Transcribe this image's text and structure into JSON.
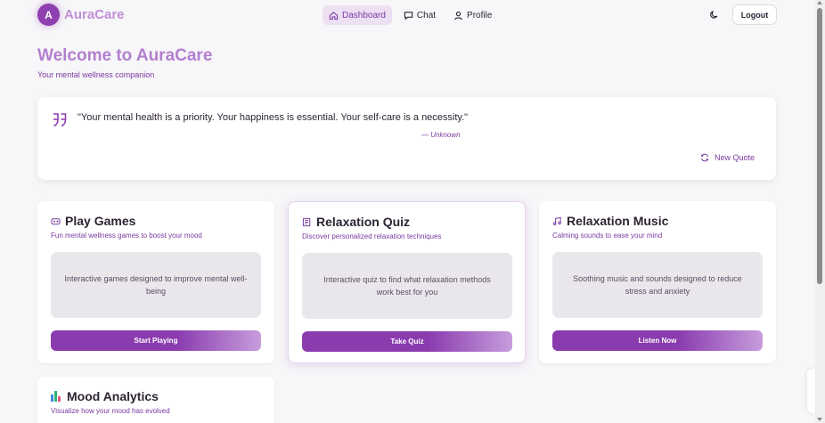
{
  "brand": {
    "initial": "A",
    "name": "AuraCare"
  },
  "nav": {
    "links": [
      {
        "label": "Dashboard",
        "icon": "home-icon",
        "active": true
      },
      {
        "label": "Chat",
        "icon": "chat-icon",
        "active": false
      },
      {
        "label": "Profile",
        "icon": "user-icon",
        "active": false
      }
    ],
    "theme_icon": "moon-icon",
    "logout_label": "Logout"
  },
  "hero": {
    "title": "Welcome to AuraCare",
    "subtitle": "Your mental wellness companion"
  },
  "quote": {
    "icon": "quote-icon",
    "text": "\"Your mental health is a priority. Your happiness is essential. Your self-care is a necessity.\"",
    "author": "— Unknown",
    "new_quote_label": "New Quote"
  },
  "cards": [
    {
      "icon": "gamepad-icon",
      "title": "Play Games",
      "subtitle": "Fun mental wellness games to boost your mood",
      "description": "Interactive games designed to improve mental well-being",
      "button": "Start Playing"
    },
    {
      "icon": "quiz-icon",
      "title": "Relaxation Quiz",
      "subtitle": "Discover personalized relaxation techniques",
      "description": "Interactive quiz to find what relaxation methods work best for you",
      "button": "Take Quiz"
    },
    {
      "icon": "music-icon",
      "title": "Relaxation Music",
      "subtitle": "Calming sounds to ease your mind",
      "description": "Soothing music and sounds designed to reduce stress and anxiety",
      "button": "Listen Now"
    },
    {
      "icon": "bar-chart-icon",
      "title": "Mood Analytics",
      "subtitle": "Visualize how your mood has evolved"
    }
  ],
  "colors": {
    "accent": "#8e3fb0",
    "brand_light": "#c08fd6",
    "active_nav_bg": "#ede0f3",
    "page_bg": "#f7f6f8"
  }
}
